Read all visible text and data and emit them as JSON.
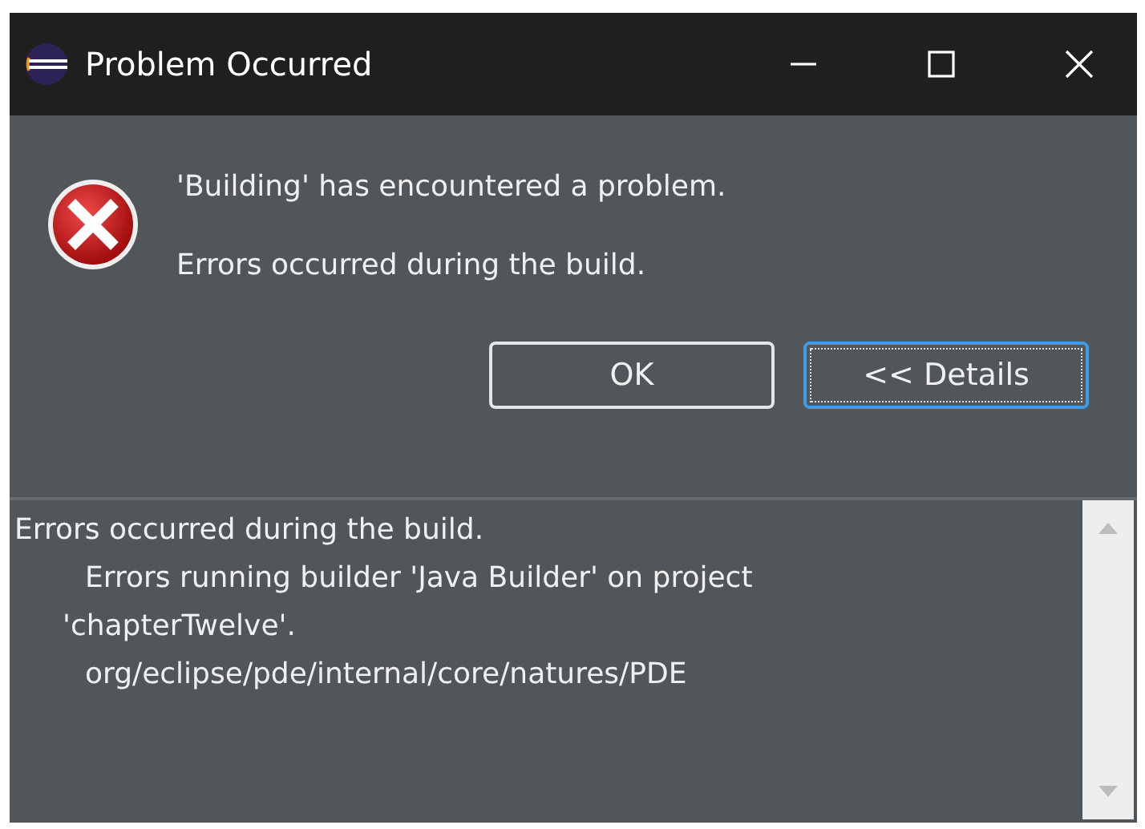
{
  "window": {
    "title": "Problem Occurred"
  },
  "message": {
    "title": "'Building' has encountered a problem.",
    "detail": "Errors occurred during the build."
  },
  "buttons": [
    {
      "label": "OK",
      "focused": false
    },
    {
      "label": "<< Details",
      "focused": true
    }
  ],
  "details": {
    "lines": [
      {
        "kind": "head",
        "text": "Errors occurred during the build."
      },
      {
        "kind": "item",
        "text": "Errors running builder 'Java Builder' on project"
      },
      {
        "kind": "continuation",
        "text": "'chapterTwelve'."
      },
      {
        "kind": "item",
        "text": "org/eclipse/pde/internal/core/natures/PDE"
      }
    ]
  }
}
